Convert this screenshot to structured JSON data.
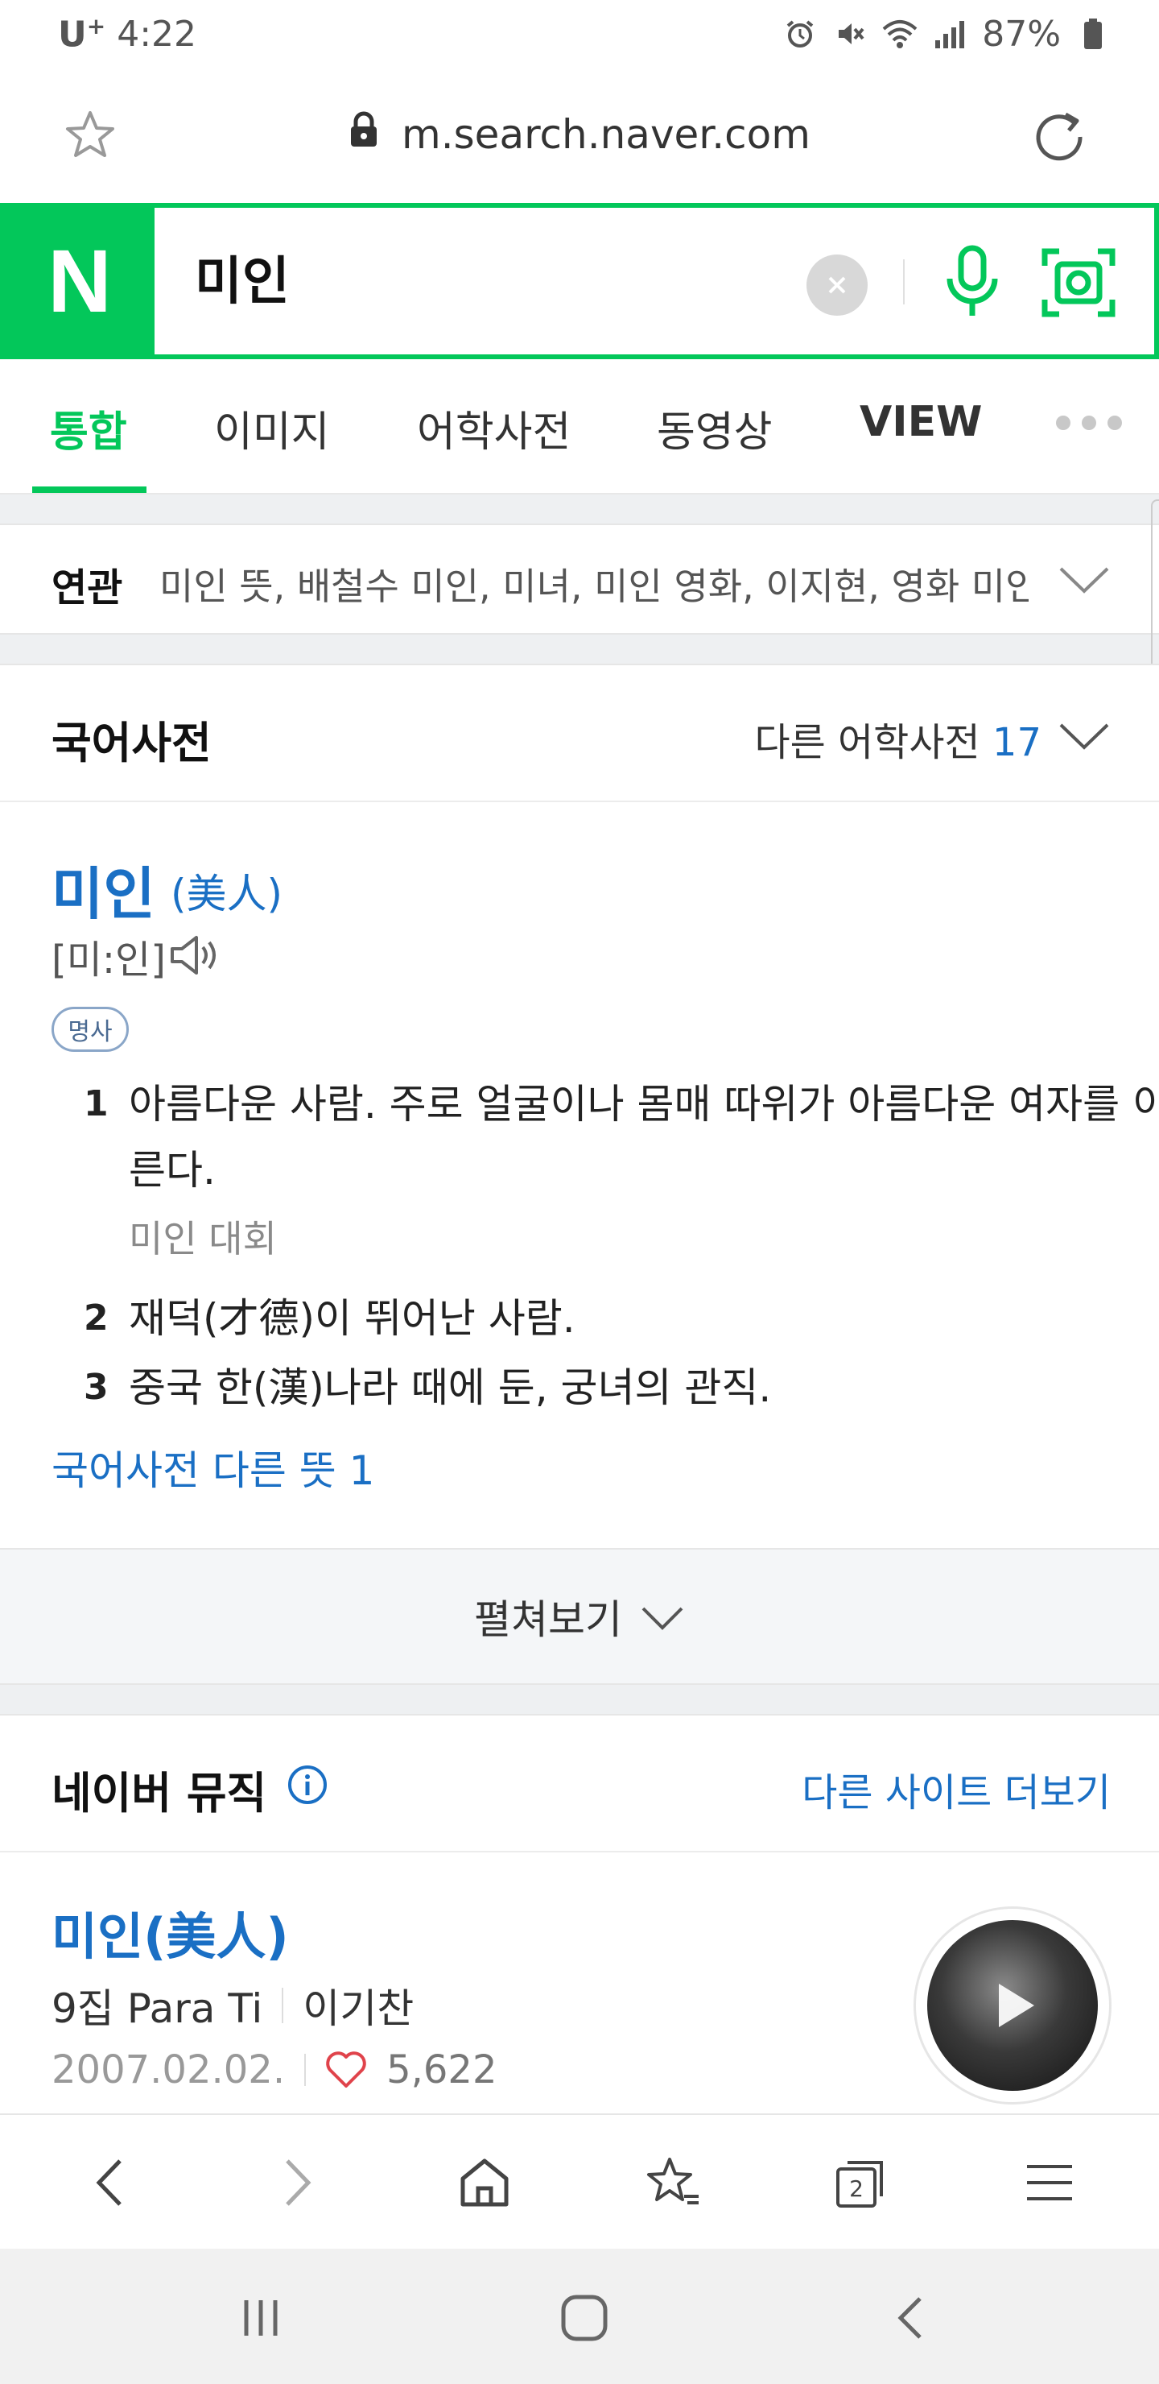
{
  "status": {
    "carrier": "U",
    "carrier_sup": "+",
    "time": "4:22",
    "battery": "87%"
  },
  "browser": {
    "url": "m.search.naver.com"
  },
  "search": {
    "logo": "N",
    "query": "미인"
  },
  "tabs": [
    {
      "label": "통합",
      "active": true
    },
    {
      "label": "이미지"
    },
    {
      "label": "어학사전"
    },
    {
      "label": "동영상"
    },
    {
      "label": "VIEW"
    }
  ],
  "related": {
    "label": "연관",
    "items": "미인 뜻, 배철수 미인, 미녀, 미인 영화, 이지현, 영화 미인"
  },
  "dictionary": {
    "title": "국어사전",
    "other_label": "다른 어학사전",
    "other_count": "17",
    "word": "미인",
    "hanja": "(美人)",
    "pronunciation": "[미:인]",
    "pos": "명사",
    "definitions": [
      {
        "num": "1",
        "text": "아름다운 사람. 주로 얼굴이나 몸매 따위가 아름다운 여자를 이른다.",
        "example": "미인 대회"
      },
      {
        "num": "2",
        "text": "재덕(才德)이 뛰어난 사람."
      },
      {
        "num": "3",
        "text": "중국 한(漢)나라 때에 둔, 궁녀의 관직."
      }
    ],
    "more_meanings": "국어사전 다른 뜻 1",
    "expand": "펼쳐보기"
  },
  "music": {
    "title": "네이버 뮤직",
    "more": "다른 사이트 더보기",
    "song_title": "미인(美人)",
    "album": "9집 Para Ti",
    "artist": "이기찬",
    "date": "2007.02.02.",
    "likes": "5,622"
  },
  "browser_nav": {
    "tabs_count": "2"
  },
  "colors": {
    "naver_green": "#03c75a",
    "link_blue": "#1a6fc4",
    "like_red": "#e0434b"
  }
}
